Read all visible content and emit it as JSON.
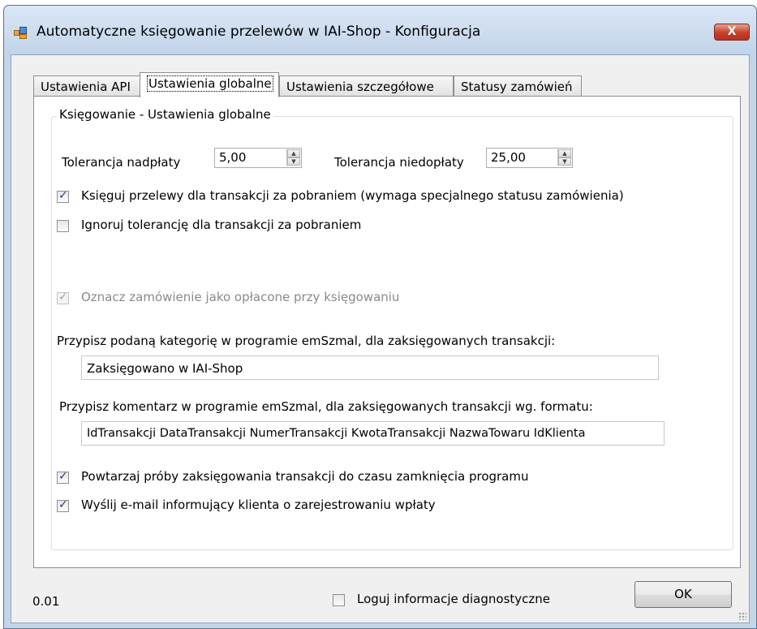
{
  "window": {
    "title": "Automatyczne księgowanie przelewów w IAI-Shop - Konfiguracja",
    "close_label": "X"
  },
  "tabs": [
    {
      "label": "Ustawienia API",
      "active": false
    },
    {
      "label": "Ustawienia globalne",
      "active": true
    },
    {
      "label": "Ustawienia szczegółowe",
      "active": false
    },
    {
      "label": "Statusy zamówień",
      "active": false
    }
  ],
  "group": {
    "title": "Księgowanie - Ustawienia globalne",
    "overpayment_label": "Tolerancja nadpłaty",
    "overpayment_value": "5,00",
    "underpayment_label": "Tolerancja niedopłaty",
    "underpayment_value": "25,00",
    "cod_post_label": "Księguj przelewy dla transakcji za pobraniem (wymaga specjalnego statusu zamówienia)",
    "cod_post_checked": true,
    "ignore_tolerance_label": "Ignoruj tolerancję dla transakcji za pobraniem",
    "ignore_tolerance_checked": false,
    "mark_paid_label": "Oznacz zamówienie jako opłacone przy księgowaniu",
    "mark_paid_checked": true,
    "category_label": "Przypisz podaną kategorię w programie emSzmal, dla zaksięgowanych transakcji:",
    "category_value": "Zaksięgowano w IAI-Shop",
    "comment_label": "Przypisz komentarz w programie emSzmal, dla zaksięgowanych transakcji wg. formatu:",
    "comment_value": "IdTransakcji DataTransakcji NumerTransakcji KwotaTransakcji NazwaTowaru IdKlienta",
    "retry_label": "Powtarzaj próby zaksięgowania transakcji do czasu zamknięcia programu",
    "retry_checked": true,
    "email_label": "Wyślij e-mail informujący klienta o zarejestrowaniu wpłaty",
    "email_checked": true
  },
  "footer": {
    "version": "0.01",
    "diagnostics_label": "Loguj informacje diagnostyczne",
    "diagnostics_checked": false,
    "ok_label": "OK"
  }
}
